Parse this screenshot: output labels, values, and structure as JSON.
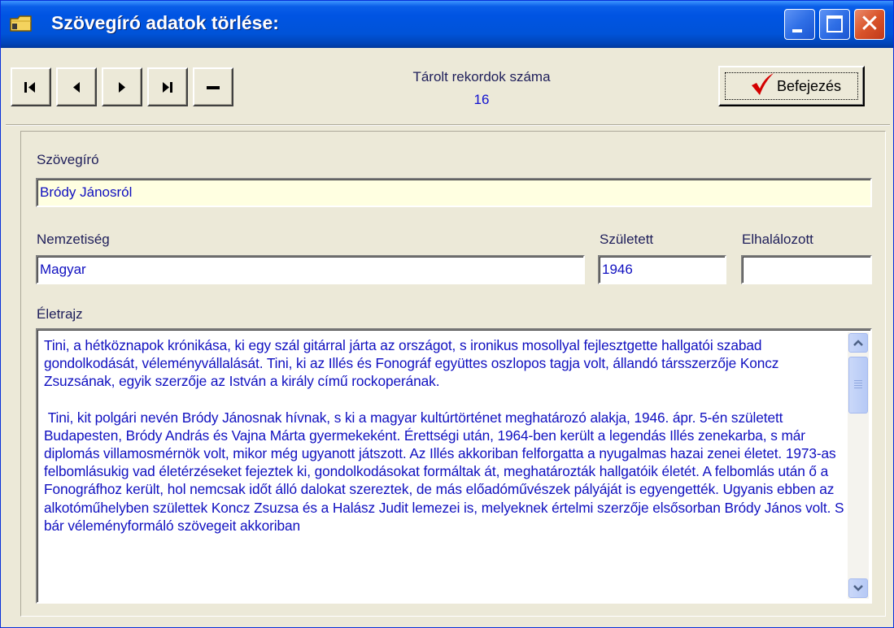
{
  "window": {
    "title": "Szövegíró adatok törlése:",
    "controls": [
      "minimize",
      "maximize",
      "close"
    ]
  },
  "toolbar": {
    "nav_buttons": [
      {
        "icon": "first-record-icon"
      },
      {
        "icon": "previous-record-icon"
      },
      {
        "icon": "next-record-icon"
      },
      {
        "icon": "last-record-icon"
      },
      {
        "icon": "delete-record-icon"
      }
    ],
    "records_label": "Tárolt rekordok száma",
    "records_count": "16",
    "finish_label": "Befejezés",
    "finish_icon": "checkmark-icon",
    "finish_icon_color": "#d40000"
  },
  "form": {
    "lyricist_label": "Szövegíró",
    "lyricist_value": "Bródy Jánosról",
    "nationality_label": "Nemzetiség",
    "nationality_value": "Magyar",
    "born_label": "Született",
    "born_value": "1946",
    "died_label": "Elhalálozott",
    "died_value": "",
    "bio_label": "Életrajz",
    "bio_paragraphs": [
      "Tini, a hétköznapok krónikása, ki egy szál gitárral járta az országot, s ironikus mosollyal fejlesztgette hallgatói szabad gondolkodását, véleményvállalását. Tini, ki az Illés és Fonográf együttes oszlopos tagja volt, állandó társszerzője Koncz Zsuzsának, egyik szerzője az István a király című rockoperának.",
      " Tini, kit polgári nevén Bródy Jánosnak hívnak, s ki a magyar kultúrtörténet meghatározó alakja, 1946. ápr. 5-én született Budapesten, Bródy András és Vajna Márta gyermekeként. Érettségi után, 1964-ben került a legendás Illés zenekarba, s már diplomás villamosmérnök volt, mikor még ugyanott játszott. Az Illés akkoriban felforgatta a nyugalmas hazai zenei életet. 1973-as felbomlásukig vad életérzéseket fejeztek ki, gondolkodásokat formáltak át, meghatározták hallgatóik életét. A felbomlás után ő a Fonográfhoz került, hol nemcsak időt álló dalokat szereztek, de más előadóművészek pályáját is egyengették. Ugyanis ebben az alkotóműhelyben születtek Koncz Zsuzsa és a Halász Judit lemezei is, melyeknek értelmi szerzője elsősorban Bródy János volt. S bár véleményformáló szövegeit akkoriban"
    ]
  },
  "colors": {
    "titlebar": "#0054e3",
    "window_bg": "#ece9d8",
    "field_text": "#1010c0",
    "highlight_field": "#ffffe1",
    "close_button": "#d9542a"
  }
}
